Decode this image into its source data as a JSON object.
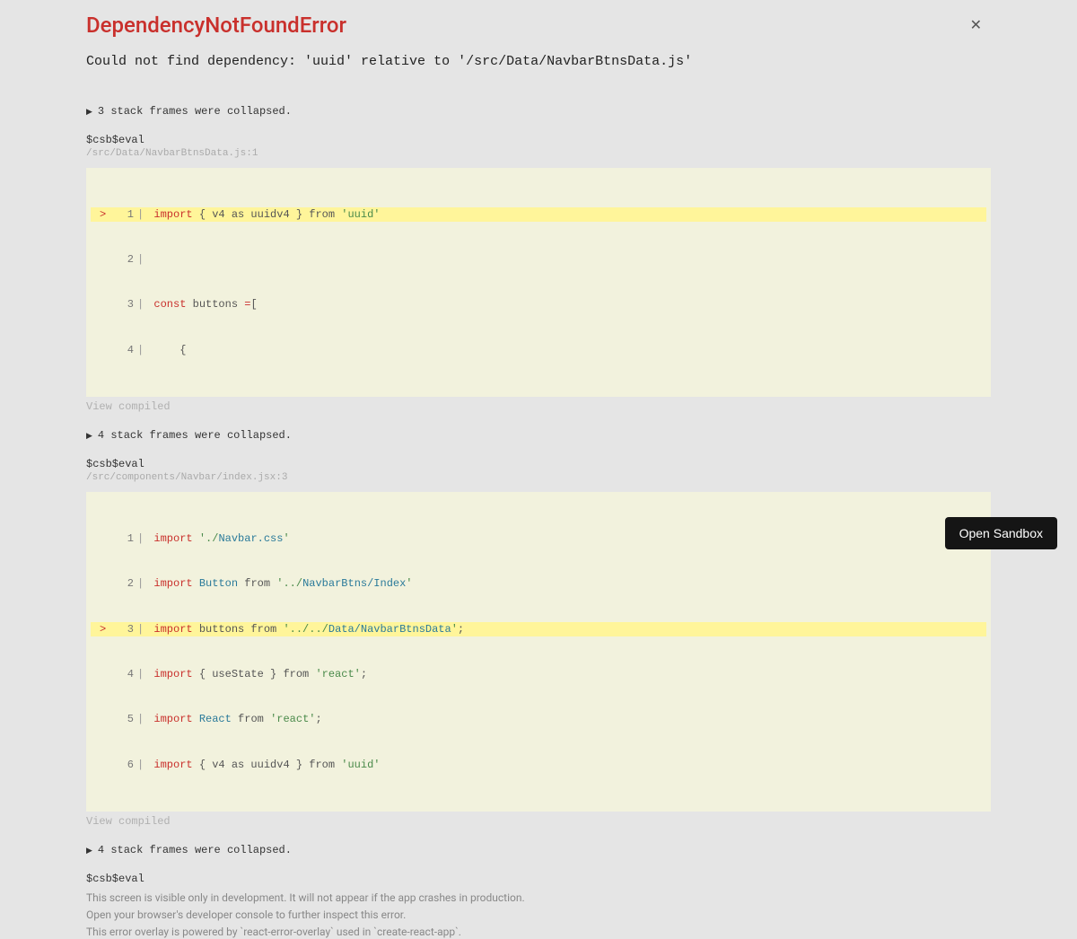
{
  "error": {
    "title": "DependencyNotFoundError",
    "message": "Could not find dependency: 'uuid' relative to '/src/Data/NavbarBtnsData.js'"
  },
  "frames": {
    "collapsed1": "3 stack frames were collapsed.",
    "collapsed2": "4 stack frames were collapsed.",
    "collapsed3": "4 stack frames were collapsed.",
    "evalLabel": "$csb$eval",
    "file1": "/src/Data/NavbarBtnsData.js:1",
    "file2": "/src/components/Navbar/index.jsx:3",
    "viewCompiled": "View compiled"
  },
  "code1": {
    "l1": {
      "n": "1",
      "marker": ">",
      "t1": "import",
      "t2": " { v4 as uuidv4 } from ",
      "t3": "'uuid'"
    },
    "l2": {
      "n": "2"
    },
    "l3": {
      "n": "3",
      "t1": "const",
      "t2": " buttons ",
      "t3": "=",
      "t4": "["
    },
    "l4": {
      "n": "4",
      "t1": "    {"
    }
  },
  "code2": {
    "l1": {
      "n": "1",
      "t1": "import",
      "t2": " ",
      "t3": "'./",
      "t4": "Navbar.css",
      "t5": "'"
    },
    "l2": {
      "n": "2",
      "t1": "import",
      "t2": " ",
      "t3": "Button",
      "t4": " from ",
      "t5": "'../",
      "t6": "NavbarBtns/Index",
      "t7": "'"
    },
    "l3": {
      "n": "3",
      "marker": ">",
      "t1": "import",
      "t2": " buttons from ",
      "t3": "'../../",
      "t4": "Data/NavbarBtnsData",
      "t5": "'",
      "t6": ";"
    },
    "l4": {
      "n": "4",
      "t1": "import",
      "t2": " { useState } from ",
      "t3": "'react'",
      "t4": ";"
    },
    "l5": {
      "n": "5",
      "t1": "import",
      "t2": " ",
      "t3": "React",
      "t4": " from ",
      "t5": "'react'",
      "t6": ";"
    },
    "l6": {
      "n": "6",
      "t1": "import",
      "t2": " { v4 as uuidv4 } from ",
      "t3": "'uuid'"
    }
  },
  "footer": {
    "l1": "This screen is visible only in development. It will not appear if the app crashes in production.",
    "l2": "Open your browser's developer console to further inspect this error.",
    "l3": "This error overlay is powered by `react-error-overlay` used in `create-react-app`."
  },
  "sandboxBtn": "Open Sandbox"
}
